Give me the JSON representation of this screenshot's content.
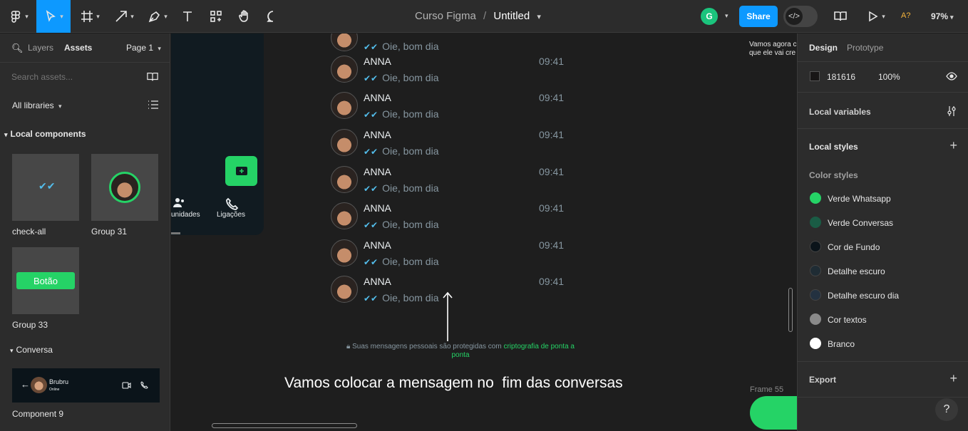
{
  "toolbar": {
    "file_path": "Curso Figma",
    "separator": "/",
    "file_name": "Untitled",
    "user_initial": "G",
    "share_label": "Share",
    "missing_fonts": "A?",
    "zoom": "97%"
  },
  "left_panel": {
    "tabs": [
      "Layers",
      "Assets"
    ],
    "page_label": "Page 1",
    "search_placeholder": "Search assets...",
    "library_filter": "All libraries",
    "section_local": "Local components",
    "components": [
      {
        "label": "check-all"
      },
      {
        "label": "Group 31"
      },
      {
        "label": "Group 33",
        "button_text": "Botão"
      }
    ],
    "section_conversa": "Conversa",
    "component9": {
      "label": "Component 9",
      "contact_name": "Brubru",
      "contact_status": "Online"
    }
  },
  "canvas": {
    "phone_nav": [
      {
        "label": "unidades"
      },
      {
        "label": "Ligações"
      }
    ],
    "messages": [
      {
        "name": "ANNA",
        "text": "Oie, bom dia",
        "time": "09:41"
      },
      {
        "name": "ANNA",
        "text": "Oie, bom dia",
        "time": "09:41"
      },
      {
        "name": "ANNA",
        "text": "Oie, bom dia",
        "time": "09:41"
      },
      {
        "name": "ANNA",
        "text": "Oie, bom dia",
        "time": "09:41"
      },
      {
        "name": "ANNA",
        "text": "Oie, bom dia",
        "time": "09:41"
      },
      {
        "name": "ANNA",
        "text": "Oie, bom dia",
        "time": "09:41"
      },
      {
        "name": "ANNA",
        "text": "Oie, bom dia",
        "time": "09:41"
      }
    ],
    "top_partial_text": "Oie, bom dia",
    "encryption_text": "Suas mensagens pessoais são protegidas com",
    "encryption_link": "criptografia de ponta a ponta",
    "annotation": "Vamos colocar a mensagem no  fim das conversas",
    "side_note_1": "Vamos agora c",
    "side_note_2": "que ele vai cre",
    "frame_label": "Frame 55"
  },
  "right_panel": {
    "tabs": [
      "Design",
      "Prototype"
    ],
    "fill_hex": "181616",
    "fill_opacity": "100%",
    "local_variables": "Local variables",
    "local_styles": "Local styles",
    "color_styles_label": "Color styles",
    "color_styles": [
      {
        "name": "Verde Whatsapp",
        "color": "#25d366"
      },
      {
        "name": "Verde Conversas",
        "color": "#1a5c45"
      },
      {
        "name": "Cor de Fundo",
        "color": "#0b141a"
      },
      {
        "name": "Detalhe escuro",
        "color": "#1f2c34"
      },
      {
        "name": "Detalhe escuro dia",
        "color": "#233140"
      },
      {
        "name": "Cor textos",
        "color": "#8a8a8a"
      },
      {
        "name": "Branco",
        "color": "#ffffff"
      }
    ],
    "export_label": "Export",
    "help": "?"
  }
}
